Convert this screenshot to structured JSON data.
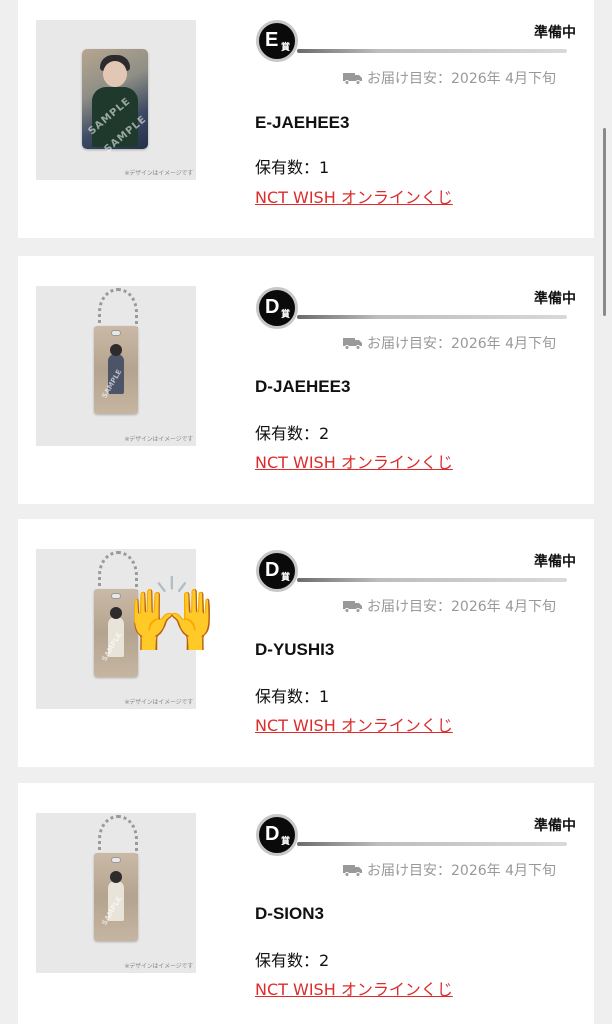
{
  "items": [
    {
      "grade_letter": "E",
      "grade_kanji": "賞",
      "status": "準備中",
      "delivery": "お届け目安：2026年 4月下旬",
      "name": "E-JAEHEE3",
      "count": "保有数：1",
      "lottery": "NCT WISH オンラインくじ",
      "image_caption": "※デザインはイメージです",
      "image_type": "photo-card"
    },
    {
      "grade_letter": "D",
      "grade_kanji": "賞",
      "status": "準備中",
      "delivery": "お届け目安：2026年 4月下旬",
      "name": "D-JAEHEE3",
      "count": "保有数：2",
      "lottery": "NCT WISH オンラインくじ",
      "image_caption": "※デザインはイメージです",
      "image_type": "acrylic-keychain"
    },
    {
      "grade_letter": "D",
      "grade_kanji": "賞",
      "status": "準備中",
      "delivery": "お届け目安：2026年 4月下旬",
      "name": "D-YUSHI3",
      "count": "保有数：1",
      "lottery": "NCT WISH オンラインくじ",
      "image_caption": "※デザインはイメージです",
      "image_type": "acrylic-keychain"
    },
    {
      "grade_letter": "D",
      "grade_kanji": "賞",
      "status": "準備中",
      "delivery": "お届け目安：2026年 4月下旬",
      "name": "D-SION3",
      "count": "保有数：2",
      "lottery": "NCT WISH オンラインくじ",
      "image_caption": "※デザインはイメージです",
      "image_type": "acrylic-keychain"
    }
  ],
  "overlay": {
    "emoji": "🙌",
    "emoji_name": "raised-hands"
  },
  "colors": {
    "link": "#dd2c2c",
    "status": "#111111",
    "delivery": "#999999",
    "badge": "#0a0a0a",
    "background": "#efefef"
  }
}
